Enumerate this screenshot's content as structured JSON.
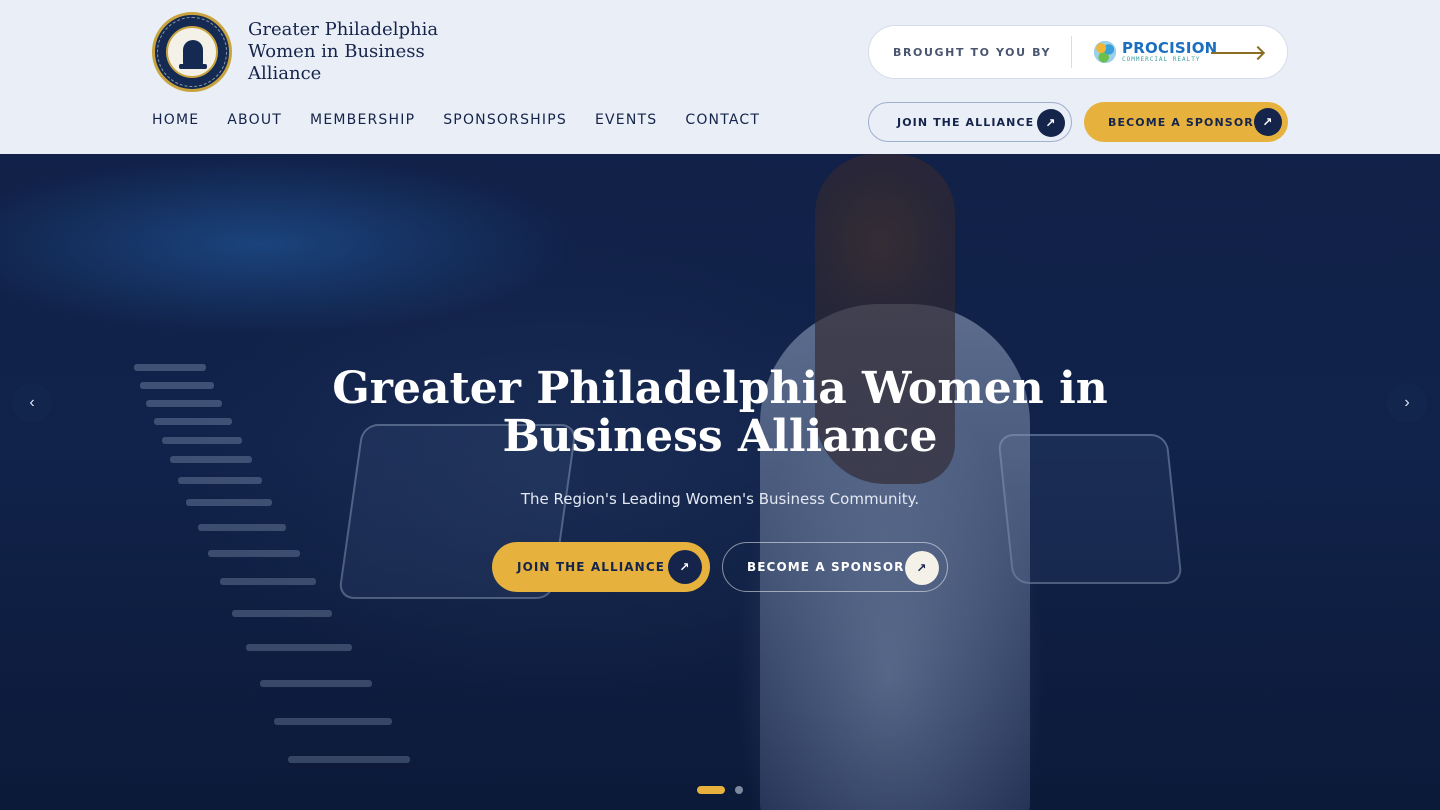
{
  "brand": {
    "name": "Greater Philadelphia Women in Business Alliance",
    "seal_icon": "liberty-bell-seal-icon"
  },
  "nav": {
    "items": [
      {
        "label": "HOME"
      },
      {
        "label": "ABOUT"
      },
      {
        "label": "MEMBERSHIP"
      },
      {
        "label": "SPONSORSHIPS"
      },
      {
        "label": "EVENTS"
      },
      {
        "label": "CONTACT"
      }
    ]
  },
  "sponsor_pill": {
    "label": "BROUGHT TO YOU BY",
    "sponsor_name": "PROCISION",
    "sponsor_sub": "COMMERCIAL REALTY"
  },
  "header_buttons": {
    "join": "JOIN THE ALLIANCE",
    "sponsor": "BECOME A SPONSOR",
    "arrow_icon": "↗"
  },
  "hero": {
    "title": "Greater Philadelphia Women in Business Alliance",
    "subtitle": "The Region's Leading Women's Business Community.",
    "join_button": "JOIN THE ALLIANCE",
    "sponsor_button": "BECOME A SPONSOR",
    "prev_icon": "‹",
    "next_icon": "›",
    "slides": {
      "count": 2,
      "active": 1
    }
  },
  "colors": {
    "navy": "#15244a",
    "gold": "#e6b23d",
    "header_bg": "#e9eef7"
  }
}
